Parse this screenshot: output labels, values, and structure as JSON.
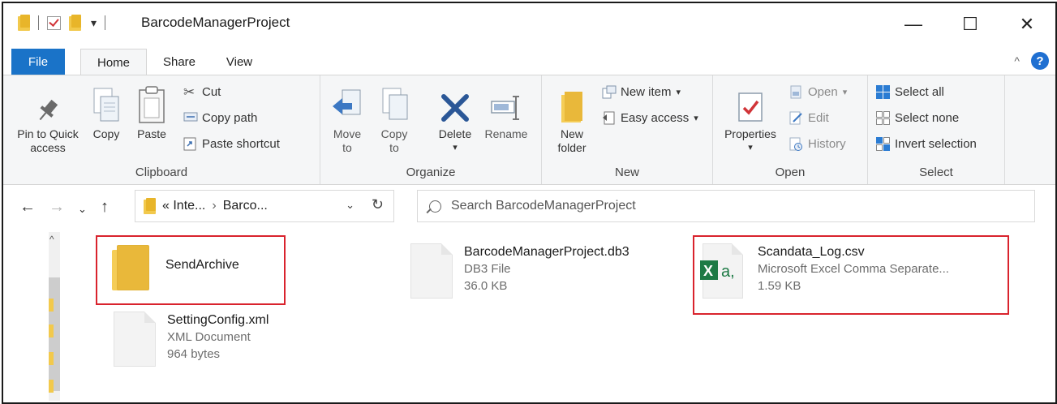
{
  "window": {
    "title": "BarcodeManagerProject",
    "caption_minimize": "—",
    "caption_maximize": "☐",
    "caption_close": "✕"
  },
  "tabs": {
    "file": "File",
    "home": "Home",
    "share": "Share",
    "view": "View",
    "help": "?"
  },
  "clipboard": {
    "pin": "Pin to Quick access",
    "copy": "Copy",
    "paste": "Paste",
    "cut": "Cut",
    "copy_path": "Copy path",
    "paste_shortcut": "Paste shortcut",
    "label": "Clipboard"
  },
  "organize": {
    "move_to": "Move to",
    "copy_to": "Copy to",
    "delete": "Delete",
    "rename": "Rename",
    "label": "Organize"
  },
  "new_group": {
    "new_folder": "New folder",
    "new_item": "New item",
    "easy_access": "Easy access",
    "label": "New"
  },
  "open_group": {
    "properties": "Properties",
    "open": "Open",
    "edit": "Edit",
    "history": "History",
    "label": "Open"
  },
  "select_group": {
    "select_all": "Select all",
    "select_none": "Select none",
    "invert": "Invert selection",
    "label": "Select"
  },
  "address": {
    "crumb1": "« Inte...",
    "crumb2": "Barco...",
    "search_placeholder": "Search BarcodeManagerProject"
  },
  "files": [
    {
      "name": "SendArchive",
      "type": "",
      "size": "",
      "icon": "folder-icon",
      "highlighted": true
    },
    {
      "name": "BarcodeManagerProject.db3",
      "type": "DB3 File",
      "size": "36.0 KB",
      "icon": "document-icon",
      "highlighted": false
    },
    {
      "name": "Scandata_Log.csv",
      "type": "Microsoft Excel Comma Separate...",
      "size": "1.59 KB",
      "icon": "excel-csv-icon",
      "highlighted": true
    },
    {
      "name": "SettingConfig.xml",
      "type": "XML Document",
      "size": "964 bytes",
      "icon": "document-icon",
      "highlighted": false
    }
  ],
  "colors": {
    "accent": "#1a73c8",
    "highlight": "#d9232d",
    "folder": "#e9b83a",
    "excel": "#1d7a45"
  }
}
